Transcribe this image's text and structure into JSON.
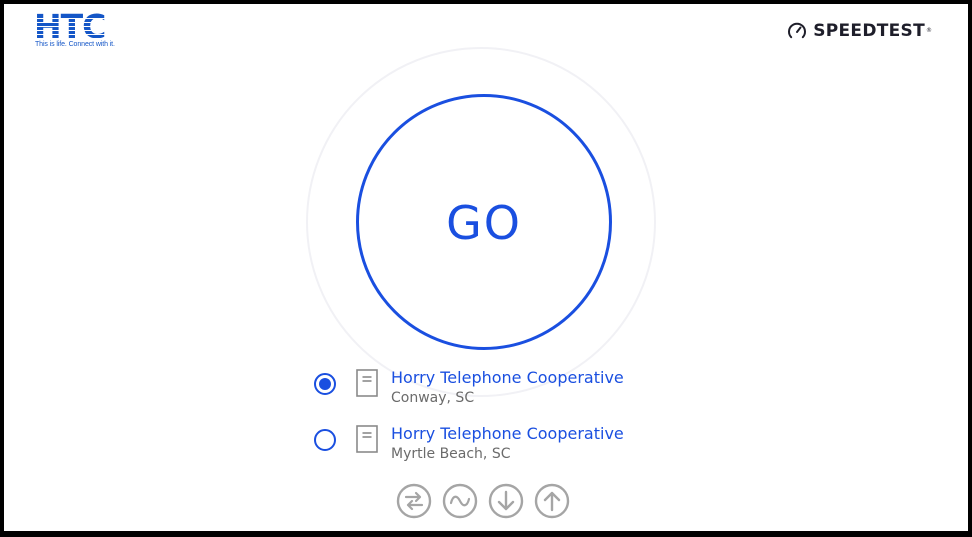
{
  "logo": {
    "mark": "HTC",
    "tagline": "This is life. Connect with it."
  },
  "brand": {
    "label": "SPEEDTEST",
    "trademark": "®",
    "icon": "speedometer-icon"
  },
  "go_button": {
    "label": "GO"
  },
  "servers": [
    {
      "name": "Horry Telephone Cooperative",
      "location": "Conway, SC",
      "selected": true
    },
    {
      "name": "Horry Telephone Cooperative",
      "location": "Myrtle Beach, SC",
      "selected": false
    }
  ],
  "metric_icons": [
    "ping-icon",
    "jitter-icon",
    "download-icon",
    "upload-icon"
  ],
  "colors": {
    "accent": "#1a4fe0",
    "logo_blue": "#1456c7",
    "muted_icon": "#a5a5a5",
    "location_text": "#6b6b6b"
  }
}
